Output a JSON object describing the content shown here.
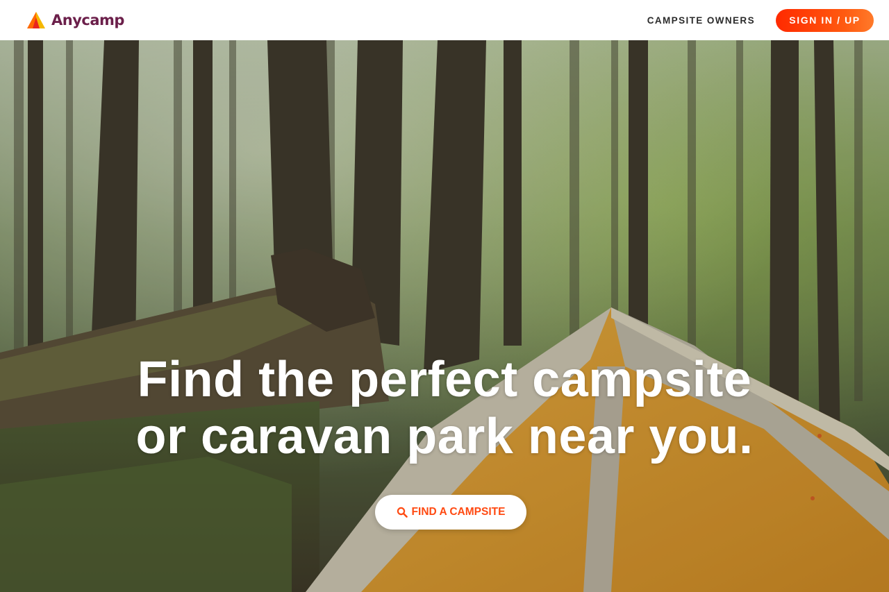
{
  "header": {
    "brand_name": "Anycamp",
    "nav": {
      "campsite_owners": "CAMPSITE OWNERS",
      "sign_in": "SIGN IN / UP"
    }
  },
  "hero": {
    "title_line_1": "Find the perfect campsite",
    "title_line_2": "or caravan park near you.",
    "cta_label": "FIND A CAMPSITE",
    "cta_icon": "search-icon"
  },
  "colors": {
    "brand_text": "#6b1f4a",
    "accent_orange": "#ff4a12",
    "sign_in_gradient_start": "#ff2a00",
    "sign_in_gradient_end": "#ff7a2a"
  }
}
